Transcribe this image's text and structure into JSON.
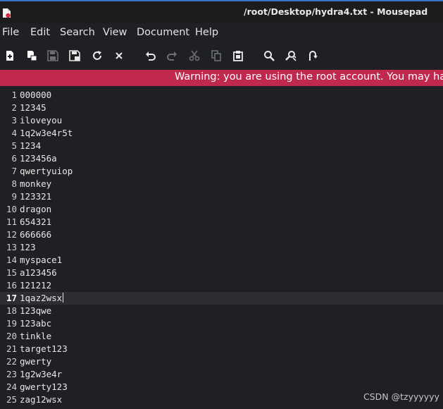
{
  "window": {
    "title": "/root/Desktop/hydra4.txt - Mousepad",
    "icon": "mousepad-app-icon"
  },
  "menubar": {
    "items": [
      "File",
      "Edit",
      "Search",
      "View",
      "Document",
      "Help"
    ]
  },
  "toolbar": {
    "buttons": [
      {
        "icon": "new-document-icon"
      },
      {
        "icon": "new-window-icon"
      },
      {
        "icon": "save-icon"
      },
      {
        "icon": "save-as-icon"
      },
      {
        "icon": "reload-icon"
      },
      {
        "icon": "close-icon"
      },
      {
        "icon": "undo-icon"
      },
      {
        "icon": "redo-icon",
        "disabled": true
      },
      {
        "icon": "cut-icon",
        "disabled": true
      },
      {
        "icon": "copy-icon",
        "disabled": true
      },
      {
        "icon": "paste-icon"
      },
      {
        "icon": "find-icon"
      },
      {
        "icon": "find-replace-icon"
      },
      {
        "icon": "go-to-line-icon"
      }
    ]
  },
  "warning": {
    "text": "Warning: you are using the root account. You may harm your"
  },
  "editor": {
    "current_line": 17,
    "lines": [
      {
        "n": "1",
        "text": "000000"
      },
      {
        "n": "2",
        "text": "12345"
      },
      {
        "n": "3",
        "text": "iloveyou"
      },
      {
        "n": "4",
        "text": "1q2w3e4r5t"
      },
      {
        "n": "5",
        "text": "1234"
      },
      {
        "n": "6",
        "text": "123456a"
      },
      {
        "n": "7",
        "text": "qwertyuiop"
      },
      {
        "n": "8",
        "text": "monkey"
      },
      {
        "n": "9",
        "text": "123321"
      },
      {
        "n": "10",
        "text": "dragon"
      },
      {
        "n": "11",
        "text": "654321"
      },
      {
        "n": "12",
        "text": "666666"
      },
      {
        "n": "13",
        "text": "123"
      },
      {
        "n": "14",
        "text": "myspace1"
      },
      {
        "n": "15",
        "text": "a123456"
      },
      {
        "n": "16",
        "text": "121212"
      },
      {
        "n": "17",
        "text": "1qaz2wsx"
      },
      {
        "n": "18",
        "text": "123qwe"
      },
      {
        "n": "19",
        "text": "123abc"
      },
      {
        "n": "20",
        "text": "tinkle"
      },
      {
        "n": "21",
        "text": "target123"
      },
      {
        "n": "22",
        "text": "gwerty"
      },
      {
        "n": "23",
        "text": "1g2w3e4r"
      },
      {
        "n": "24",
        "text": "gwerty123"
      },
      {
        "n": "25",
        "text": "zag12wsx"
      }
    ]
  },
  "watermark": {
    "text": "CSDN @tzyyyyyy"
  },
  "colors": {
    "warning_bg": "#c0284d",
    "editor_bg": "#1e2023",
    "current_line_bg": "#2c2e31"
  }
}
